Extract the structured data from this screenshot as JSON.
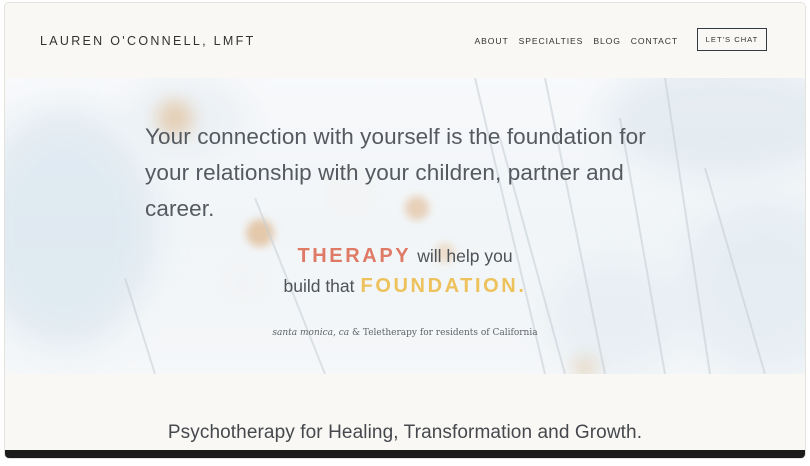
{
  "header": {
    "logo": "LAUREN O'CONNELL, LMFT",
    "nav": [
      {
        "label": "ABOUT"
      },
      {
        "label": "SPECIALTIES"
      },
      {
        "label": "BLOG"
      },
      {
        "label": "CONTACT"
      }
    ],
    "cta_label": "LET'S CHAT"
  },
  "hero": {
    "headline": "Your connection with yourself is the foundation for your relationship with your children, partner and career.",
    "therapy_word": "THERAPY",
    "tagline_part1": "will help you",
    "tagline_part2": "build that",
    "foundation_word": "FOUNDATION.",
    "location_italic": "santa monica, ca",
    "location_rest": " & Teletherapy for residents of California"
  },
  "section": {
    "title": "Psychotherapy for Healing, Transformation and Growth."
  },
  "colors": {
    "therapy_accent": "#df7a66",
    "foundation_accent": "#edc25d",
    "page_background": "#faf8f4"
  },
  "icons": [
    "dandelion-background-image"
  ]
}
